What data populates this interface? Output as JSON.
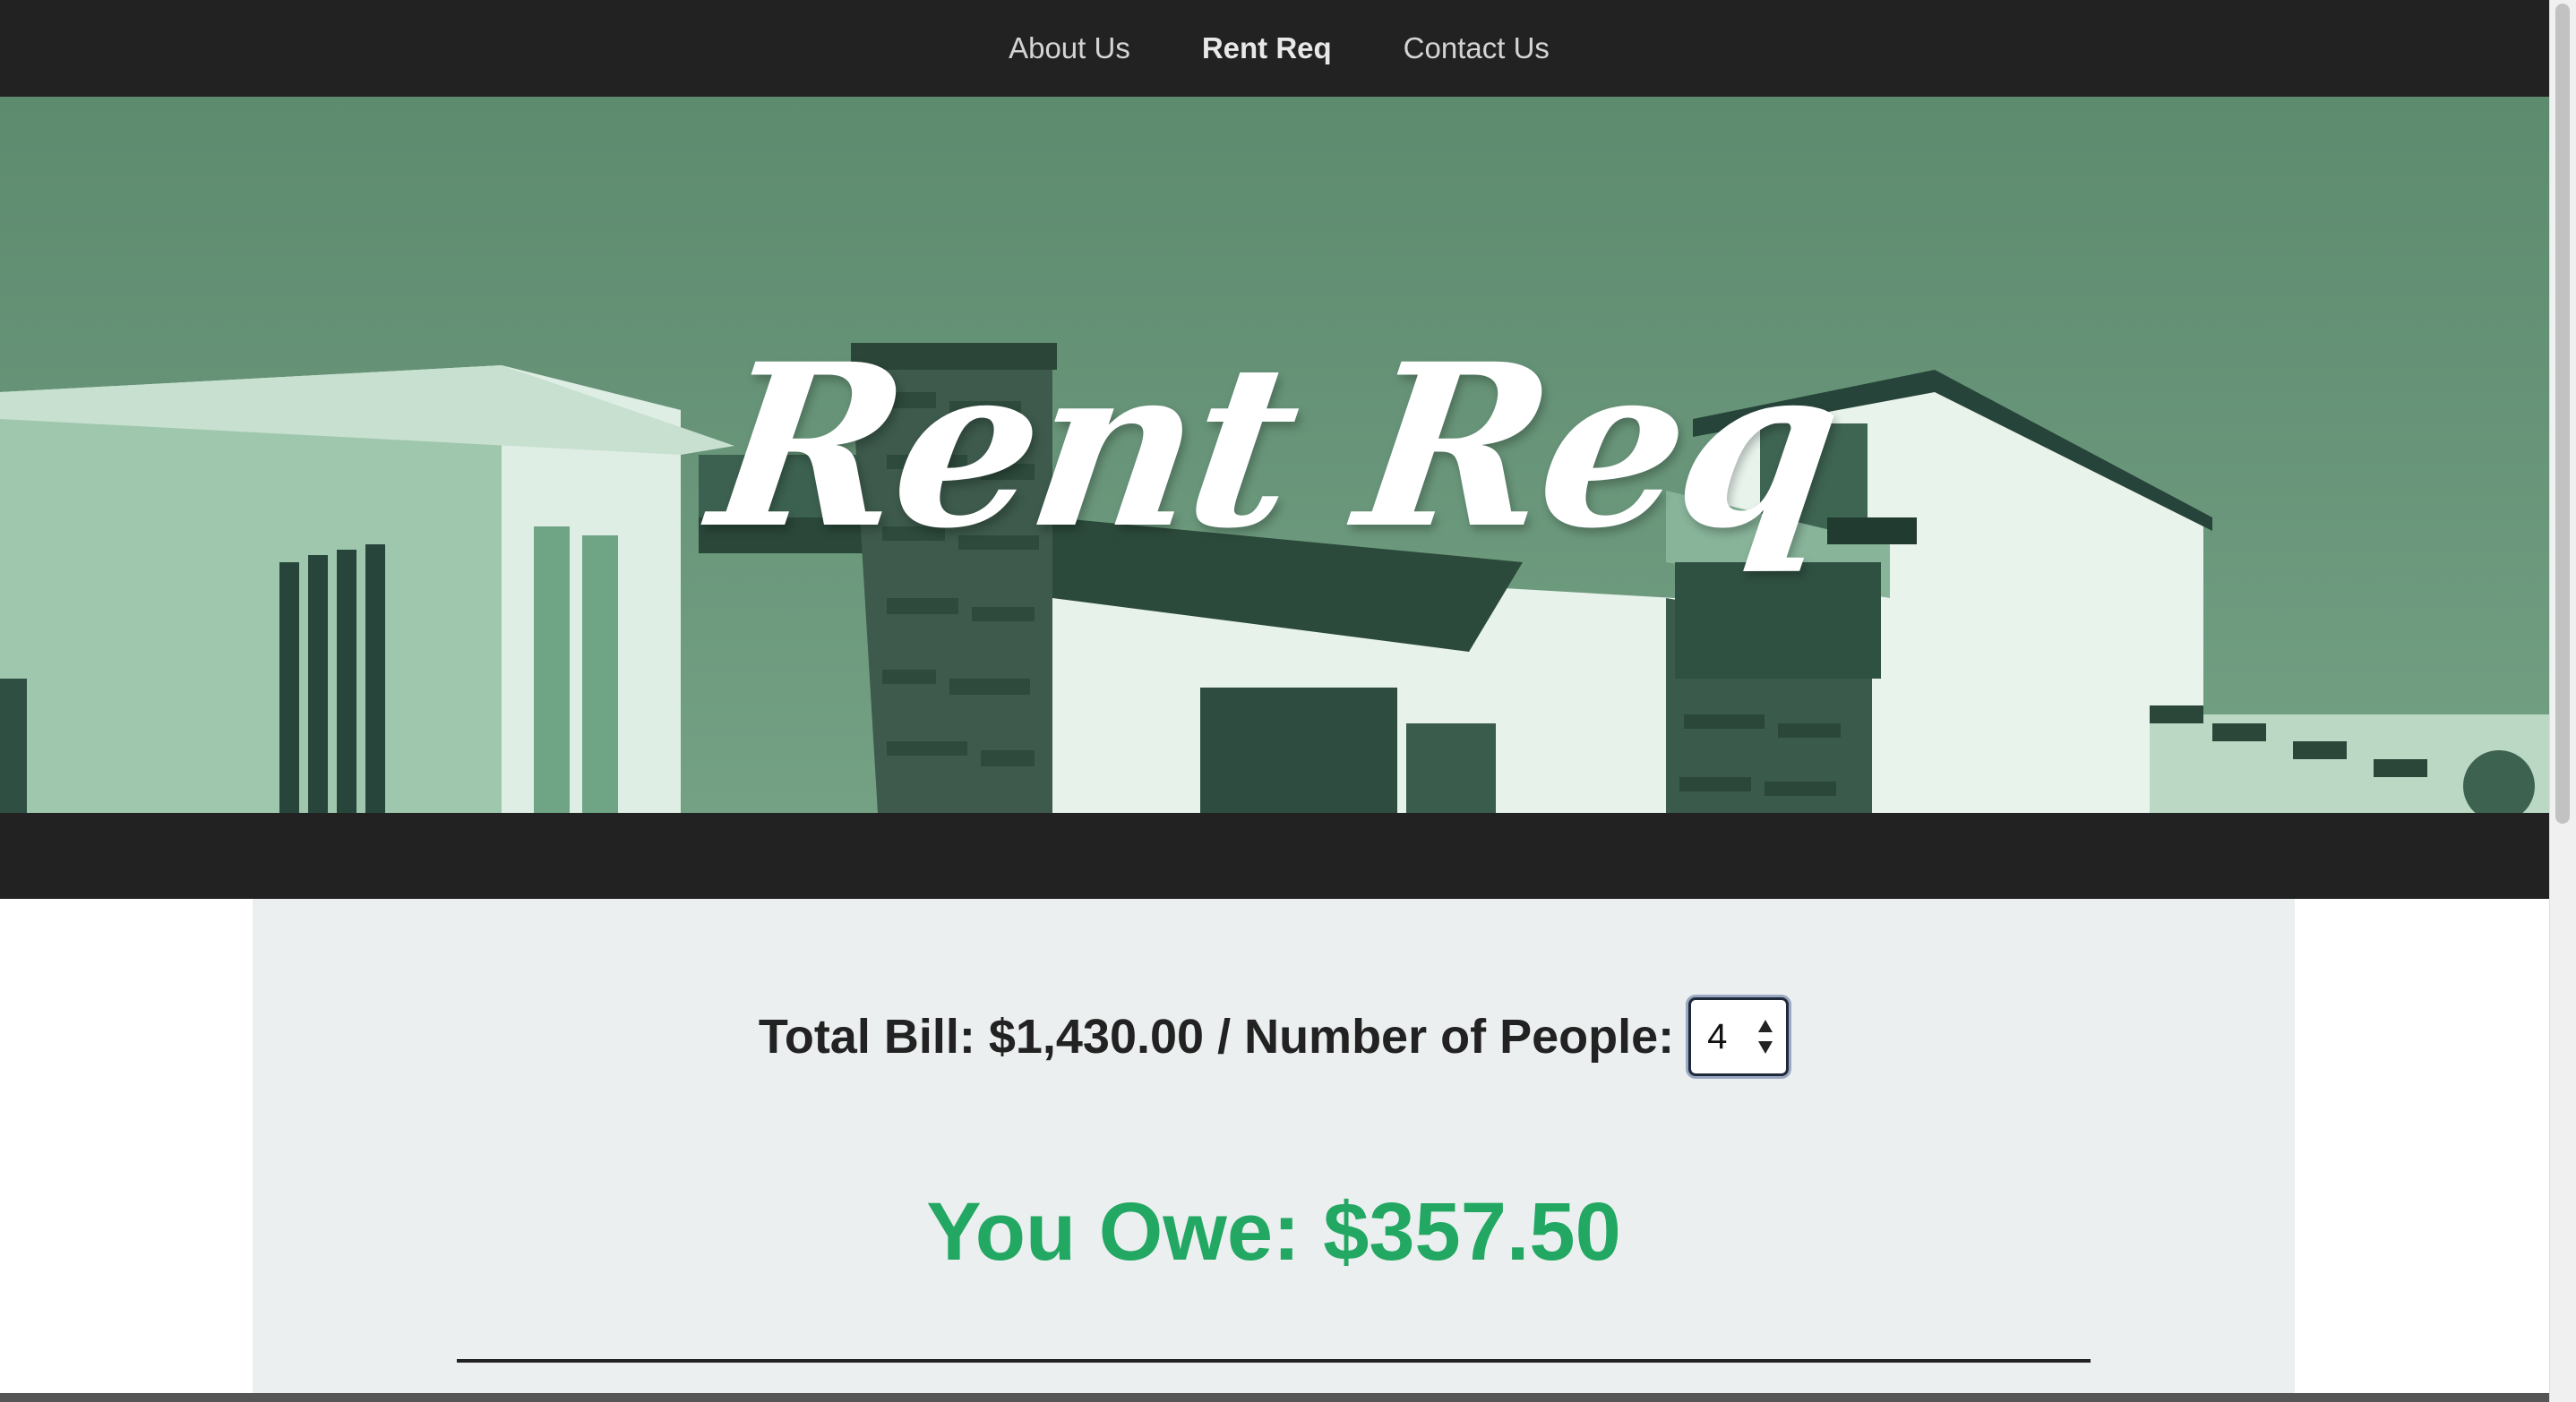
{
  "nav": {
    "items": [
      {
        "label": "About Us",
        "active": false
      },
      {
        "label": "Rent Req",
        "active": true
      },
      {
        "label": "Contact Us",
        "active": false
      }
    ]
  },
  "hero": {
    "title": "Rent Req",
    "image": "modern-house-green-tint"
  },
  "calculator": {
    "bill_text": "Total Bill: $1,430.00 / Number of People:",
    "people_selected": "4",
    "result_text": "You Owe: $357.50"
  },
  "colors": {
    "nav_bg": "#222222",
    "accent_green": "#22a862",
    "panel_bg": "#ebeff0",
    "hero_tint": "#5d8b6e"
  }
}
